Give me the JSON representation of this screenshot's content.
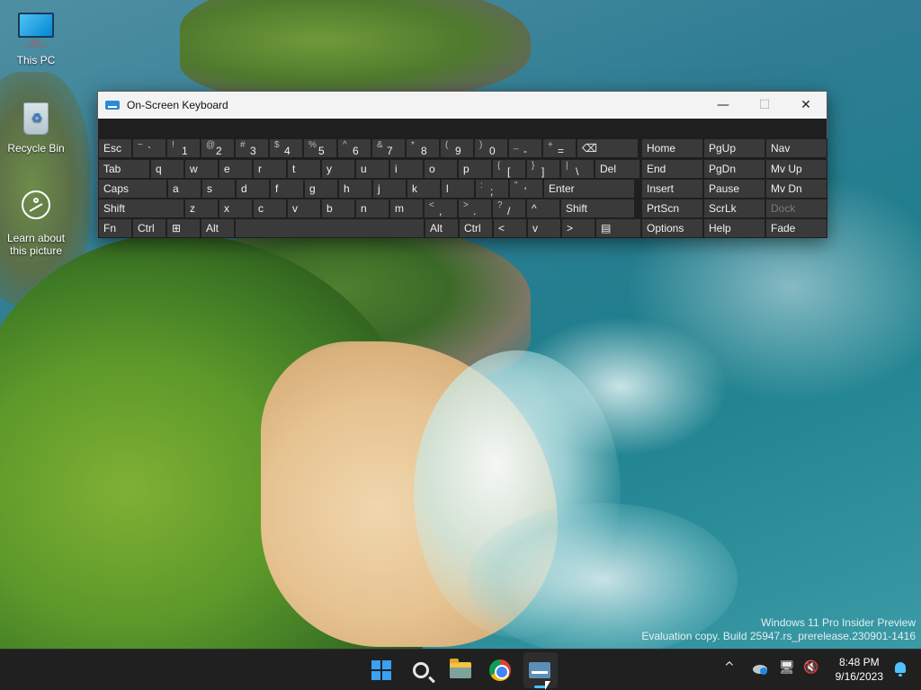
{
  "desktop": {
    "icons": [
      {
        "label": "This PC"
      },
      {
        "label": "Recycle Bin"
      },
      {
        "label": "Learn about this picture"
      }
    ],
    "watermark": {
      "line1": "Windows 11 Pro Insider Preview",
      "line2": "Evaluation copy. Build 25947.rs_prerelease.230901-1416"
    }
  },
  "osk": {
    "title": "On-Screen Keyboard",
    "controls": {
      "minimize": "—",
      "maximize": "☐",
      "close": "✕"
    },
    "row1": [
      {
        "main": "Esc"
      },
      {
        "shift": "~",
        "main": "`"
      },
      {
        "shift": "!",
        "main": "1"
      },
      {
        "shift": "@",
        "main": "2"
      },
      {
        "shift": "#",
        "main": "3"
      },
      {
        "shift": "$",
        "main": "4"
      },
      {
        "shift": "%",
        "main": "5"
      },
      {
        "shift": "^",
        "main": "6"
      },
      {
        "shift": "&",
        "main": "7"
      },
      {
        "shift": "*",
        "main": "8"
      },
      {
        "shift": "(",
        "main": "9"
      },
      {
        "shift": ")",
        "main": "0"
      },
      {
        "shift": "_",
        "main": "-"
      },
      {
        "shift": "+",
        "main": "="
      },
      {
        "main": "⌫"
      }
    ],
    "row2": [
      {
        "main": "Tab"
      },
      {
        "main": "q"
      },
      {
        "main": "w"
      },
      {
        "main": "e"
      },
      {
        "main": "r"
      },
      {
        "main": "t"
      },
      {
        "main": "y"
      },
      {
        "main": "u"
      },
      {
        "main": "i"
      },
      {
        "main": "o"
      },
      {
        "main": "p"
      },
      {
        "shift": "{",
        "main": "["
      },
      {
        "shift": "}",
        "main": "]"
      },
      {
        "shift": "|",
        "main": "\\"
      },
      {
        "main": "Del"
      }
    ],
    "row3": [
      {
        "main": "Caps"
      },
      {
        "main": "a"
      },
      {
        "main": "s"
      },
      {
        "main": "d"
      },
      {
        "main": "f"
      },
      {
        "main": "g"
      },
      {
        "main": "h"
      },
      {
        "main": "j"
      },
      {
        "main": "k"
      },
      {
        "main": "l"
      },
      {
        "shift": ":",
        "main": ";"
      },
      {
        "shift": "\"",
        "main": "'"
      },
      {
        "main": "Enter"
      }
    ],
    "row4": [
      {
        "main": "Shift"
      },
      {
        "main": "z"
      },
      {
        "main": "x"
      },
      {
        "main": "c"
      },
      {
        "main": "v"
      },
      {
        "main": "b"
      },
      {
        "main": "n"
      },
      {
        "main": "m"
      },
      {
        "shift": "<",
        "main": ","
      },
      {
        "shift": ">",
        "main": "."
      },
      {
        "shift": "?",
        "main": "/"
      },
      {
        "main": "^"
      },
      {
        "main": "Shift"
      }
    ],
    "row5": [
      {
        "main": "Fn"
      },
      {
        "main": "Ctrl"
      },
      {
        "main": "⊞"
      },
      {
        "main": "Alt"
      },
      {
        "main": ""
      },
      {
        "main": "Alt"
      },
      {
        "main": "Ctrl"
      },
      {
        "main": "<"
      },
      {
        "main": "v"
      },
      {
        "main": ">"
      },
      {
        "main": "▤"
      }
    ],
    "nav": [
      [
        "Home",
        "PgUp",
        "Nav"
      ],
      [
        "End",
        "PgDn",
        "Mv Up"
      ],
      [
        "Insert",
        "Pause",
        "Mv Dn"
      ],
      [
        "PrtScn",
        "ScrLk",
        "Dock"
      ],
      [
        "Options",
        "Help",
        "Fade"
      ]
    ]
  },
  "taskbar": {
    "clock": {
      "time": "8:48 PM",
      "date": "9/16/2023"
    },
    "tray": {
      "chevron": "^",
      "network": "🖥",
      "volume": "🔇"
    }
  }
}
